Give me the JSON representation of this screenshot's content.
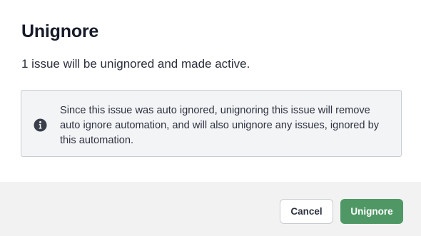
{
  "dialog": {
    "title": "Unignore",
    "description": "1 issue will be unignored and made active.",
    "notice": {
      "icon": "info-icon",
      "text": "Since this issue was auto ignored, unignoring this issue will remove auto ignore automation, and will also unignore any issues, ignored by this automation."
    },
    "buttons": {
      "cancel_label": "Cancel",
      "confirm_label": "Unignore"
    }
  },
  "colors": {
    "confirm_button": "#4f9865",
    "footer_background": "#f2f2f3",
    "notice_background": "#f3f4f6",
    "icon": "#3b3f4a"
  }
}
